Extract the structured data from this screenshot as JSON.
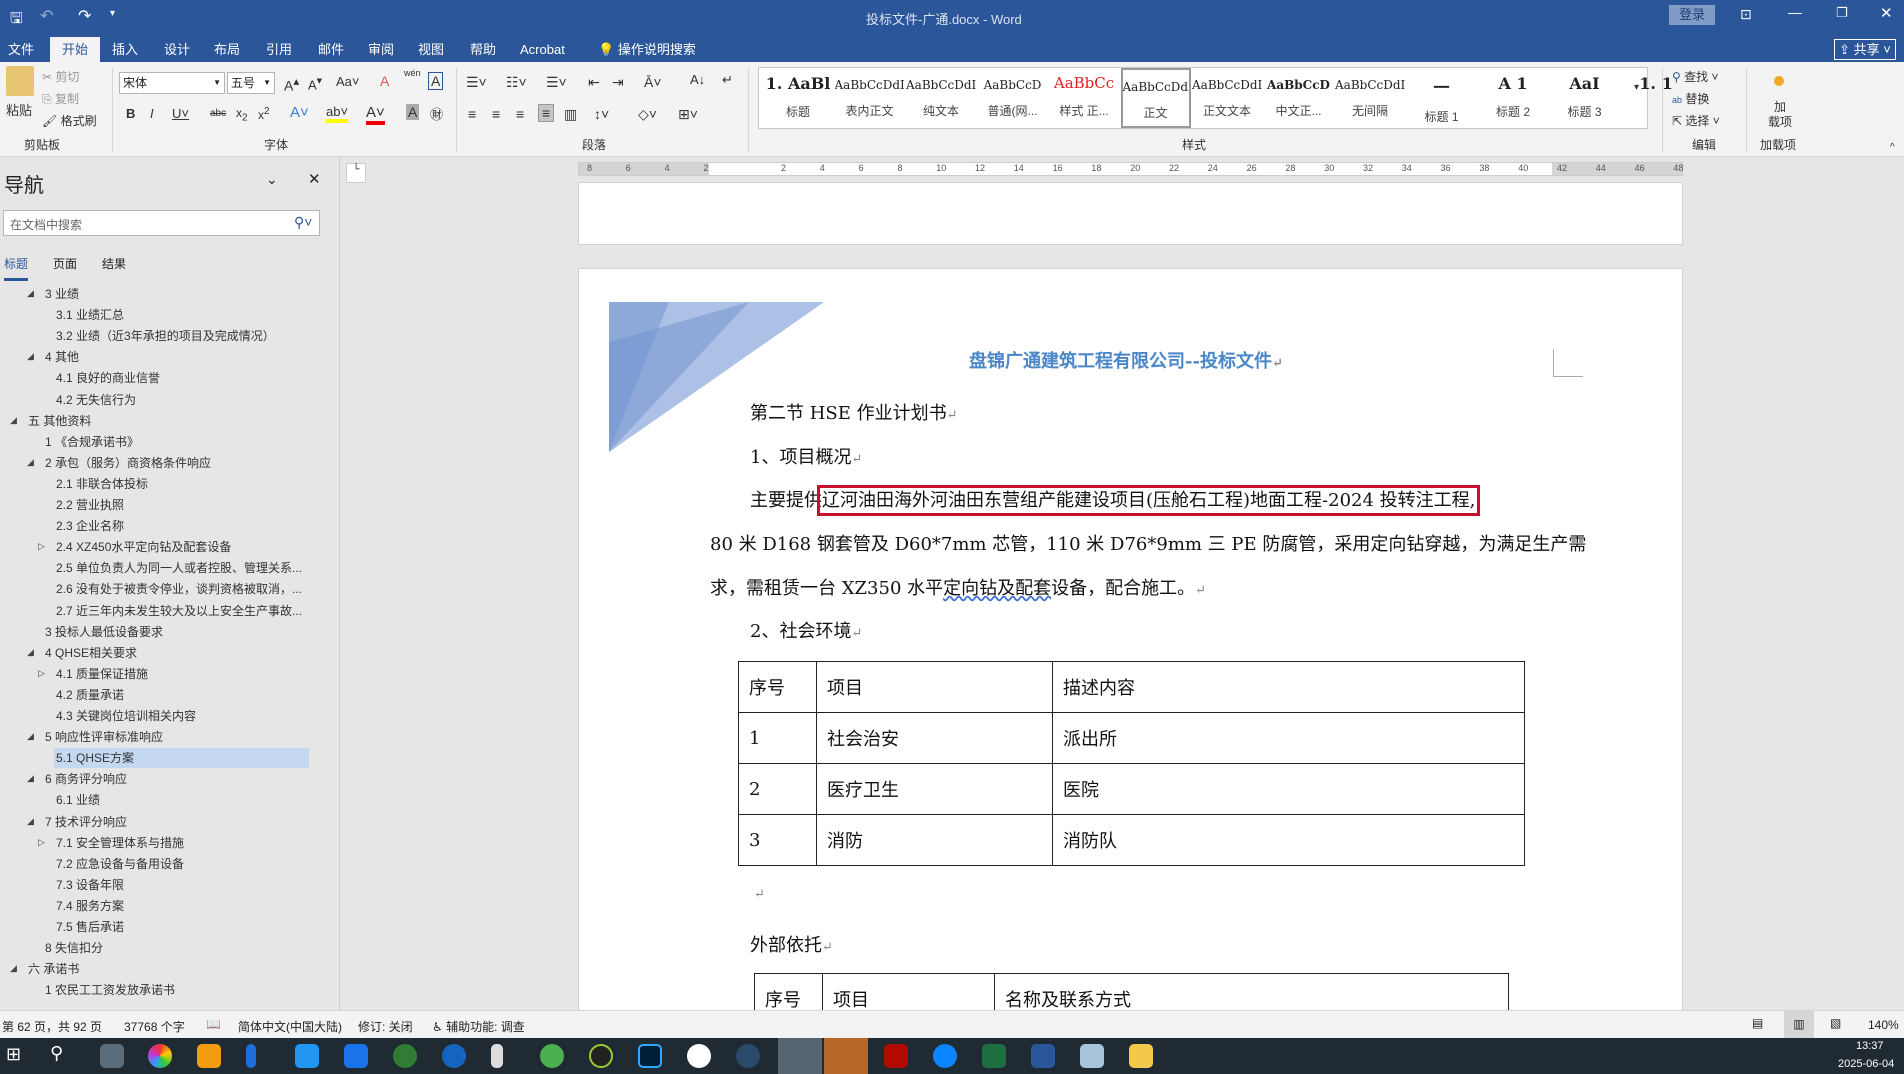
{
  "window": {
    "title": "投标文件-广通.docx - Word",
    "login": "登录",
    "share": "共享"
  },
  "tabs": [
    "文件",
    "开始",
    "插入",
    "设计",
    "布局",
    "引用",
    "邮件",
    "审阅",
    "视图",
    "帮助",
    "Acrobat"
  ],
  "tell_me": "操作说明搜索",
  "ribbon": {
    "clipboard": {
      "paste": "粘贴",
      "cut": "剪切",
      "copy": "复制",
      "format_painter": "格式刷",
      "label": "剪贴板"
    },
    "font": {
      "name": "宋体",
      "size": "五号",
      "label": "字体",
      "case": "Aa",
      "phonetic": "wén"
    },
    "paragraph": {
      "label": "段落"
    },
    "styles": {
      "label": "样式",
      "items": [
        {
          "preview": "1. AaBl",
          "name": "标题"
        },
        {
          "preview": "AaBbCcDdI",
          "name": "表内正文"
        },
        {
          "preview": "AaBbCcDdI",
          "name": "纯文本"
        },
        {
          "preview": "AaBbCcD",
          "name": "普通(网..."
        },
        {
          "preview": "AaBbCc",
          "name": "样式 正..."
        },
        {
          "preview": "AaBbCcDdI",
          "name": "正文"
        },
        {
          "preview": "AaBbCcDdI",
          "name": "正文文本"
        },
        {
          "preview": "AaBbCcD",
          "name": "中文正..."
        },
        {
          "preview": "AaBbCcDdI",
          "name": "无间隔"
        },
        {
          "preview": "一",
          "name": "标题 1"
        },
        {
          "preview": "A 1",
          "name": "标题 2"
        },
        {
          "preview": "AaI",
          "name": "标题 3"
        },
        {
          "preview": "1. 1",
          "name": ""
        }
      ]
    },
    "editing": {
      "find": "查找",
      "replace": "替换",
      "select": "选择",
      "label": "编辑"
    },
    "addins": {
      "button": "加\n载项",
      "label": "加载项"
    }
  },
  "nav": {
    "title": "导航",
    "search_placeholder": "在文档中搜索",
    "tabs": [
      "标题",
      "页面",
      "结果"
    ],
    "items": [
      {
        "t": "3 业绩",
        "l": 1,
        "e": "open"
      },
      {
        "t": "3.1 业绩汇总",
        "l": 2
      },
      {
        "t": "3.2 业绩（近3年承担的项目及完成情况）",
        "l": 2
      },
      {
        "t": "4 其他",
        "l": 1,
        "e": "open"
      },
      {
        "t": "4.1 良好的商业信誉",
        "l": 2
      },
      {
        "t": "4.2 无失信行为",
        "l": 2
      },
      {
        "t": "五 其他资料",
        "l": 0,
        "e": "open"
      },
      {
        "t": "1 《合规承诺书》",
        "l": 1
      },
      {
        "t": "2 承包（服务）商资格条件响应",
        "l": 1,
        "e": "open"
      },
      {
        "t": "2.1 非联合体投标",
        "l": 2
      },
      {
        "t": "2.2 营业执照",
        "l": 2
      },
      {
        "t": "2.3 企业名称",
        "l": 2
      },
      {
        "t": "2.4 XZ450水平定向钻及配套设备",
        "l": 2,
        "e": "closed"
      },
      {
        "t": "2.5 单位负责人为同一人或者控股、管理关系...",
        "l": 2
      },
      {
        "t": "2.6 没有处于被责令停业，谈判资格被取消，...",
        "l": 2
      },
      {
        "t": "2.7 近三年内未发生较大及以上安全生产事故...",
        "l": 2
      },
      {
        "t": "3 投标人最低设备要求",
        "l": 1
      },
      {
        "t": "4 QHSE相关要求",
        "l": 1,
        "e": "open"
      },
      {
        "t": "4.1 质量保证措施",
        "l": 2,
        "e": "closed"
      },
      {
        "t": "4.2 质量承诺",
        "l": 2
      },
      {
        "t": "4.3 关键岗位培训相关内容",
        "l": 2
      },
      {
        "t": "5 响应性评审标准响应",
        "l": 1,
        "e": "open"
      },
      {
        "t": "5.1 QHSE方案",
        "l": 2,
        "sel": true
      },
      {
        "t": "6 商务评分响应",
        "l": 1,
        "e": "open"
      },
      {
        "t": "6.1 业绩",
        "l": 2
      },
      {
        "t": "7 技术评分响应",
        "l": 1,
        "e": "open"
      },
      {
        "t": "7.1 安全管理体系与措施",
        "l": 2,
        "e": "closed"
      },
      {
        "t": "7.2 应急设备与备用设备",
        "l": 2
      },
      {
        "t": "7.3 设备年限",
        "l": 2
      },
      {
        "t": "7.4 服务方案",
        "l": 2
      },
      {
        "t": "7.5 售后承诺",
        "l": 2
      },
      {
        "t": "8 失信扣分",
        "l": 1
      },
      {
        "t": "六 承诺书",
        "l": 0,
        "e": "open"
      },
      {
        "t": "1 农民工工资发放承诺书",
        "l": 1
      }
    ]
  },
  "ruler": [
    "8",
    "6",
    "4",
    "2",
    "",
    "2",
    "4",
    "6",
    "8",
    "10",
    "12",
    "14",
    "16",
    "18",
    "20",
    "22",
    "24",
    "26",
    "28",
    "30",
    "32",
    "34",
    "36",
    "38",
    "40",
    "42",
    "44",
    "46",
    "48"
  ],
  "doc": {
    "header": "盘锦广通建筑工程有限公司--投标文件",
    "section": "第二节 HSE 作业计划书",
    "h1": "1、项目概况",
    "p1_prefix": "主要提供",
    "p1_highlight": "辽河油田海外河油田东营组产能建设项目(压舱石工程)地面工程-2024 投转注工程,",
    "p1_line2": "80 米 D168 钢套管及 D60*7mm 芯管，110 米 D76*9mm 三 PE 防腐管，采用定向钻穿越，为满足生产需",
    "p1_line3a": "求，需租赁一台 XZ350 水平",
    "p1_line3u": "定向钻及配套",
    "p1_line3b": "设备，配合施工。",
    "h2": "2、社会环境",
    "table1": {
      "headers": [
        "序号",
        "项目",
        "描述内容"
      ],
      "rows": [
        [
          "1",
          "社会治安",
          "派出所"
        ],
        [
          "2",
          "医疗卫生",
          "医院"
        ],
        [
          "3",
          "消防",
          "消防队"
        ]
      ]
    },
    "h3": "外部依托",
    "table2": {
      "headers": [
        "序号",
        "项目",
        "名称及联系方式"
      ]
    },
    "mark": "↵"
  },
  "status": {
    "page": "第 62 页，共 92 页",
    "words": "37768 个字",
    "lang": "简体中文(中国大陆)",
    "track": "修订: 关闭",
    "access": "辅助功能: 调查",
    "zoom": "140%"
  },
  "taskbar": {
    "time": "13:37",
    "date": "2025-06-04"
  },
  "colors": {
    "brand": "#2b579a",
    "highlight_box": "#c8102e",
    "header_text": "#4a86c8"
  }
}
